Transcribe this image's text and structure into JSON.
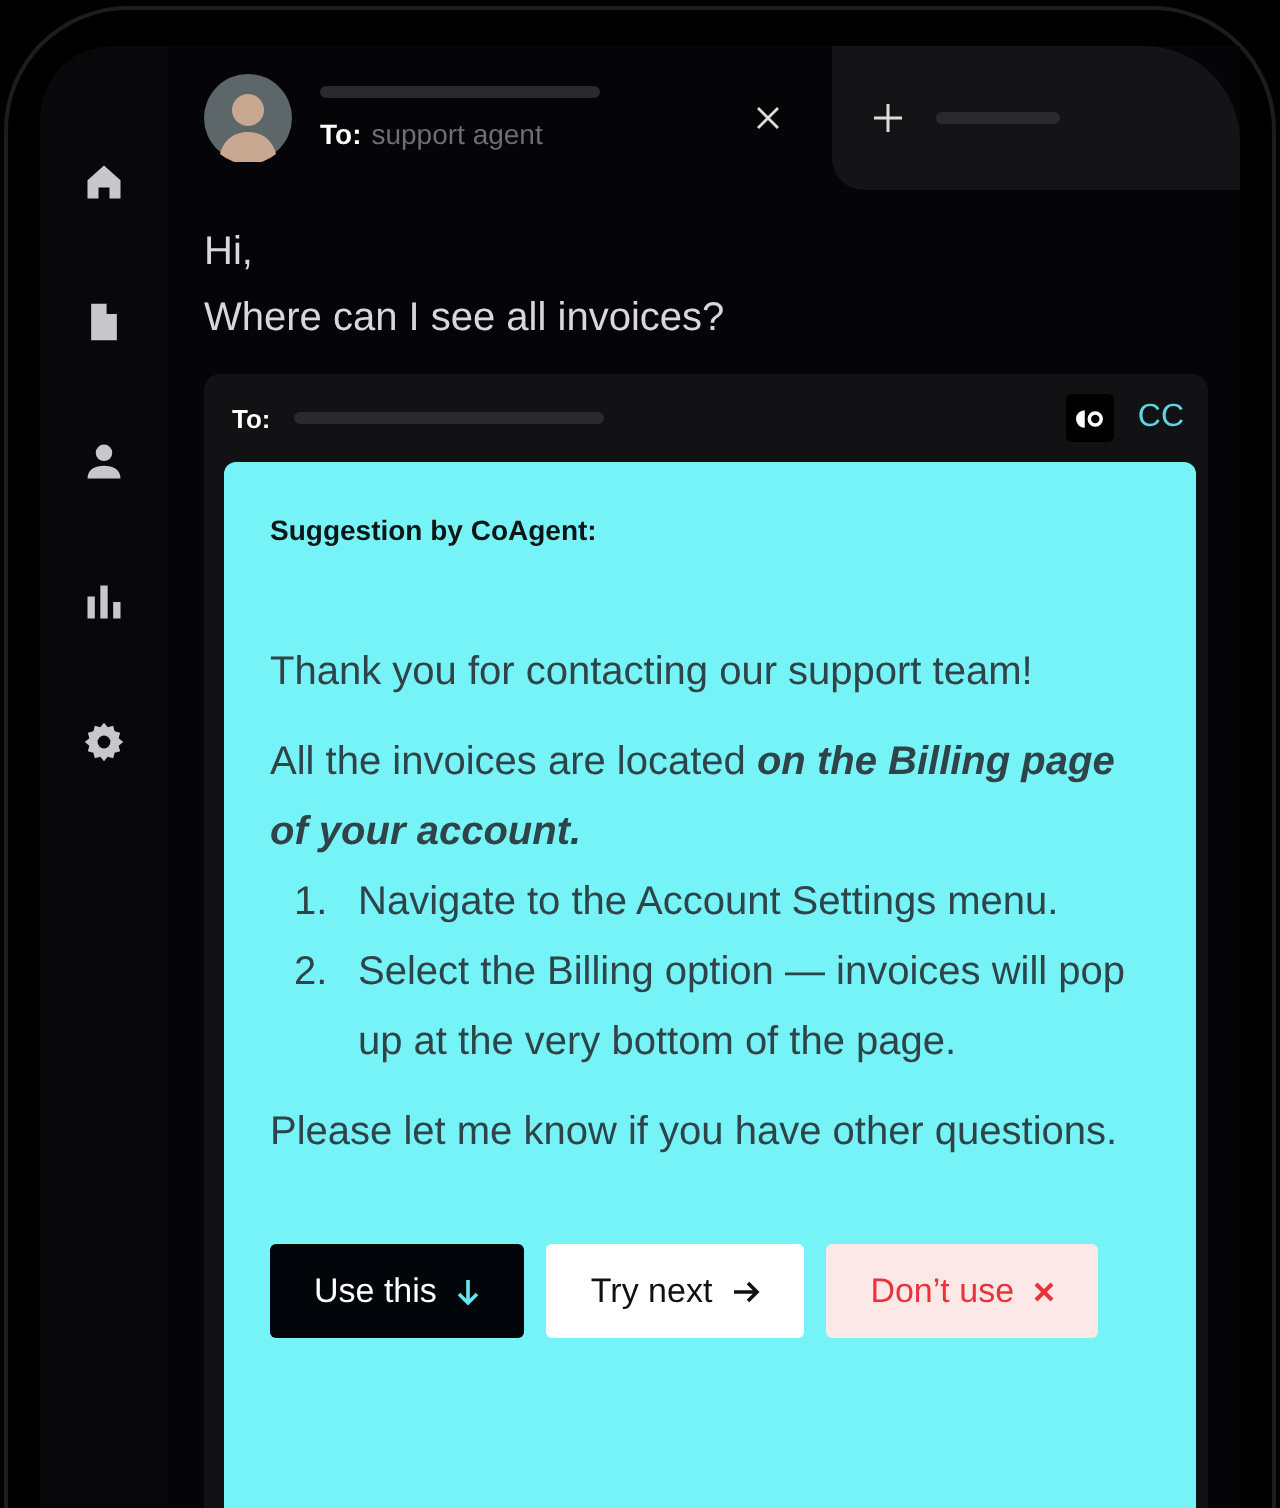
{
  "sidebar": {
    "items": [
      {
        "kind": "home",
        "selected": false
      },
      {
        "kind": "document",
        "selected": false
      },
      {
        "kind": "person",
        "selected": false
      },
      {
        "kind": "chart",
        "selected": false
      },
      {
        "kind": "settings",
        "selected": false
      }
    ]
  },
  "tabs": [
    {
      "kind": "chat",
      "selected": true,
      "to_label": "To:",
      "to_value": "support agent"
    },
    {
      "kind": "new",
      "selected": false
    }
  ],
  "message": {
    "lines": [
      "Hi,",
      "Where can I see all invoices?"
    ]
  },
  "composer": {
    "to_label": "To:",
    "cc": "CC"
  },
  "suggestion": {
    "title": "Suggestion by CoAgent:",
    "intro": "Thank you for contacting our support team!",
    "lead": "All the invoices are located **on the Billing page of your account.**",
    "steps": [
      {
        "number": "1.",
        "text": "Navigate to the Account Settings menu."
      },
      {
        "number": "2.",
        "text": "Select the Billing option — invoices will pop up at the very bottom of the page."
      }
    ],
    "closing": "Please let me know if you have other questions.",
    "buttons": [
      {
        "kind": "primary",
        "label": "Use this"
      },
      {
        "kind": "secondary",
        "label": "Try next"
      },
      {
        "kind": "danger",
        "label": "Don’t use"
      }
    ]
  }
}
